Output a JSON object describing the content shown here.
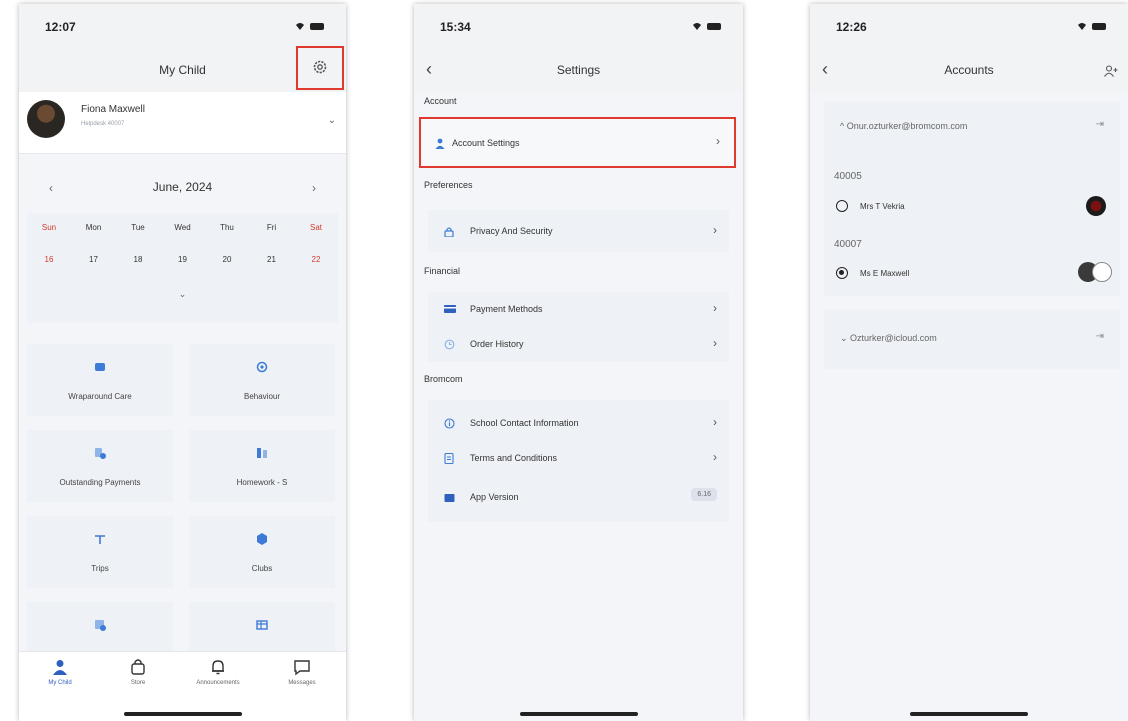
{
  "phone1": {
    "time": "12:07",
    "title": "My Child",
    "child_name": "Fiona Maxwell",
    "child_sub": "Helpdesk 40007",
    "calendar": {
      "month": "June, 2024",
      "days": [
        "Sun",
        "Mon",
        "Tue",
        "Wed",
        "Thu",
        "Fri",
        "Sat"
      ],
      "dates": [
        "16",
        "17",
        "18",
        "19",
        "20",
        "21",
        "22"
      ]
    },
    "tiles": [
      "Wraparound Care",
      "Behaviour",
      "Outstanding Payments",
      "Homework - S",
      "Trips",
      "Clubs"
    ],
    "tabs": [
      "My Child",
      "Store",
      "Announcements",
      "Messages"
    ]
  },
  "phone2": {
    "time": "15:34",
    "title": "Settings",
    "sections": {
      "account": "Account",
      "preferences": "Preferences",
      "financial": "Financial",
      "bromcom": "Bromcom"
    },
    "rows": {
      "account_settings": "Account Settings",
      "privacy": "Privacy And Security",
      "payment_methods": "Payment Methods",
      "order_history": "Order History",
      "school_contact": "School Contact Information",
      "terms": "Terms and Conditions",
      "app_version": "App Version"
    },
    "version_value": "6.16"
  },
  "phone3": {
    "time": "12:26",
    "title": "Accounts",
    "account1_email": "Onur.ozturker@bromcom.com",
    "students": [
      {
        "id": "40005",
        "name": "Mrs T Vekria",
        "selected": false
      },
      {
        "id": "40007",
        "name": "Ms E Maxwell",
        "selected": true
      }
    ],
    "account2_email": "Ozturker@icloud.com"
  },
  "colors": {
    "accent_blue": "#2f5fbf",
    "highlight_red": "#e03a2f",
    "weekend_red": "#d23a2e"
  }
}
